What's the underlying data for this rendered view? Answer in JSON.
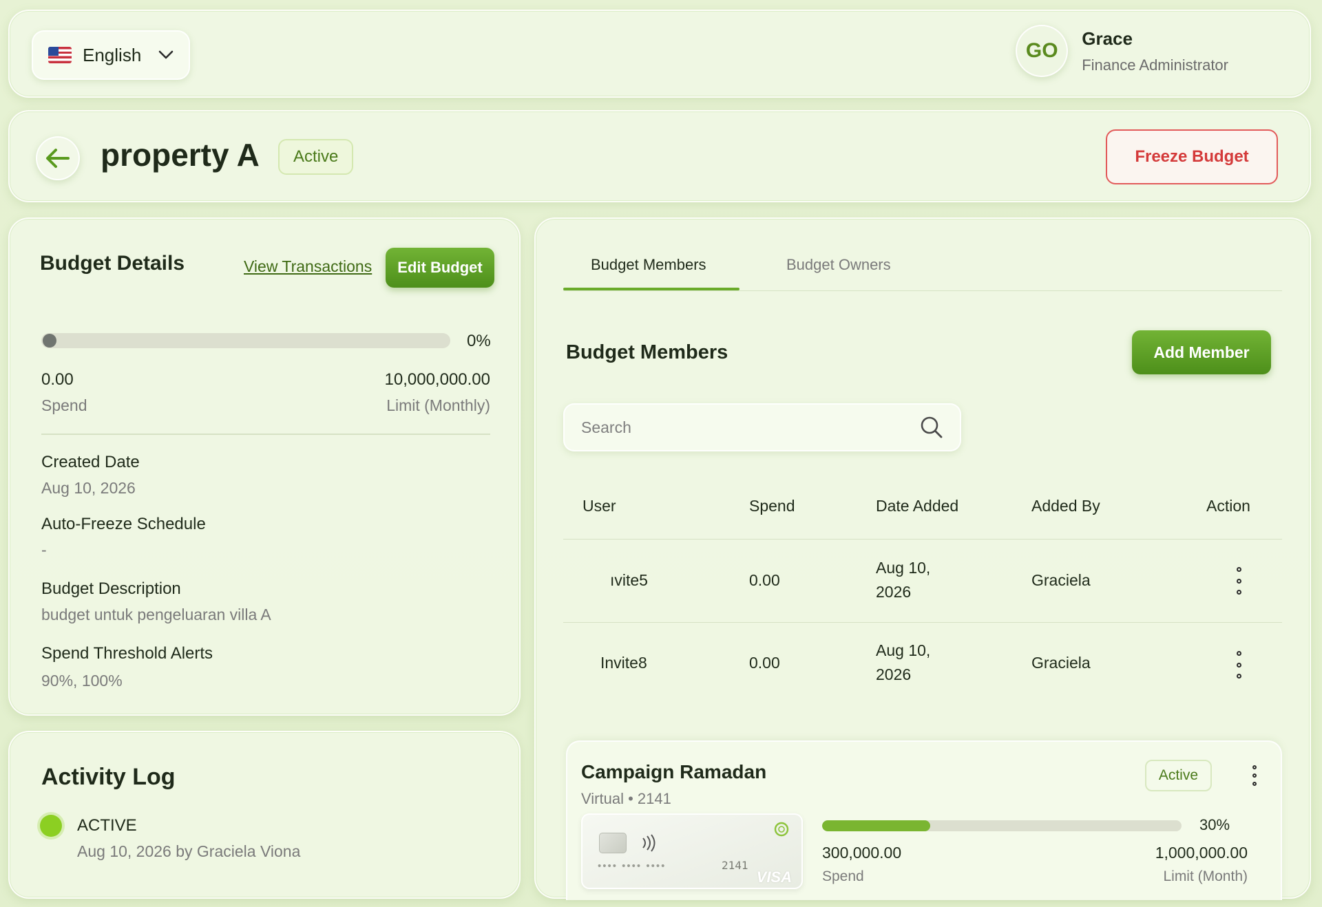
{
  "topbar": {
    "language": "English",
    "user": {
      "initials": "GO",
      "name": "Grace",
      "role": "Finance Administrator"
    }
  },
  "header": {
    "title": "property A",
    "status": "Active",
    "freeze_label": "Freeze Budget"
  },
  "details": {
    "title": "Budget Details",
    "view_transactions": "View Transactions",
    "edit_budget": "Edit Budget",
    "progress_percent": 0,
    "progress_label": "0%",
    "spend_value": "0.00",
    "spend_label": "Spend",
    "limit_value": "10,000,000.00",
    "limit_label": "Limit (Monthly)",
    "fields": [
      {
        "label": "Created Date",
        "value": "Aug 10, 2026"
      },
      {
        "label": "Auto-Freeze Schedule",
        "value": "-"
      },
      {
        "label": "Budget Description",
        "value": "budget untuk pengeluaran villa A"
      },
      {
        "label": "Spend Threshold Alerts",
        "value": "90%, 100%"
      }
    ]
  },
  "activity": {
    "title": "Activity Log",
    "entries": [
      {
        "status": "ACTIVE",
        "meta": "Aug 10, 2026 by Graciela Viona"
      }
    ]
  },
  "members": {
    "tabs": [
      {
        "label": "Budget Members",
        "active": true
      },
      {
        "label": "Budget Owners",
        "active": false
      }
    ],
    "title": "Budget Members",
    "add_label": "Add Member",
    "search_placeholder": "Search",
    "columns": [
      "User",
      "Spend",
      "Date Added",
      "Added By",
      "Action"
    ],
    "rows": [
      {
        "user": "ıvite5",
        "spend": "0.00",
        "date_line1": "Aug 10,",
        "date_line2": "2026",
        "added_by": "Graciela"
      },
      {
        "user": "Invite8",
        "spend": "0.00",
        "date_line1": "Aug 10,",
        "date_line2": "2026",
        "added_by": "Graciela"
      }
    ]
  },
  "card": {
    "name": "Campaign Ramadan",
    "type": "Virtual",
    "last4": "2141",
    "status": "Active",
    "progress_percent": 30,
    "progress_label": "30%",
    "spend_value": "300,000.00",
    "spend_label": "Spend",
    "limit_value": "1,000,000.00",
    "limit_label": "Limit (Month)",
    "masked_number": "•••• •••• ••••",
    "brand": "VISA"
  },
  "colors": {
    "accent": "#6aab2a",
    "danger": "#d43a3a",
    "background": "#e4f0d0"
  }
}
